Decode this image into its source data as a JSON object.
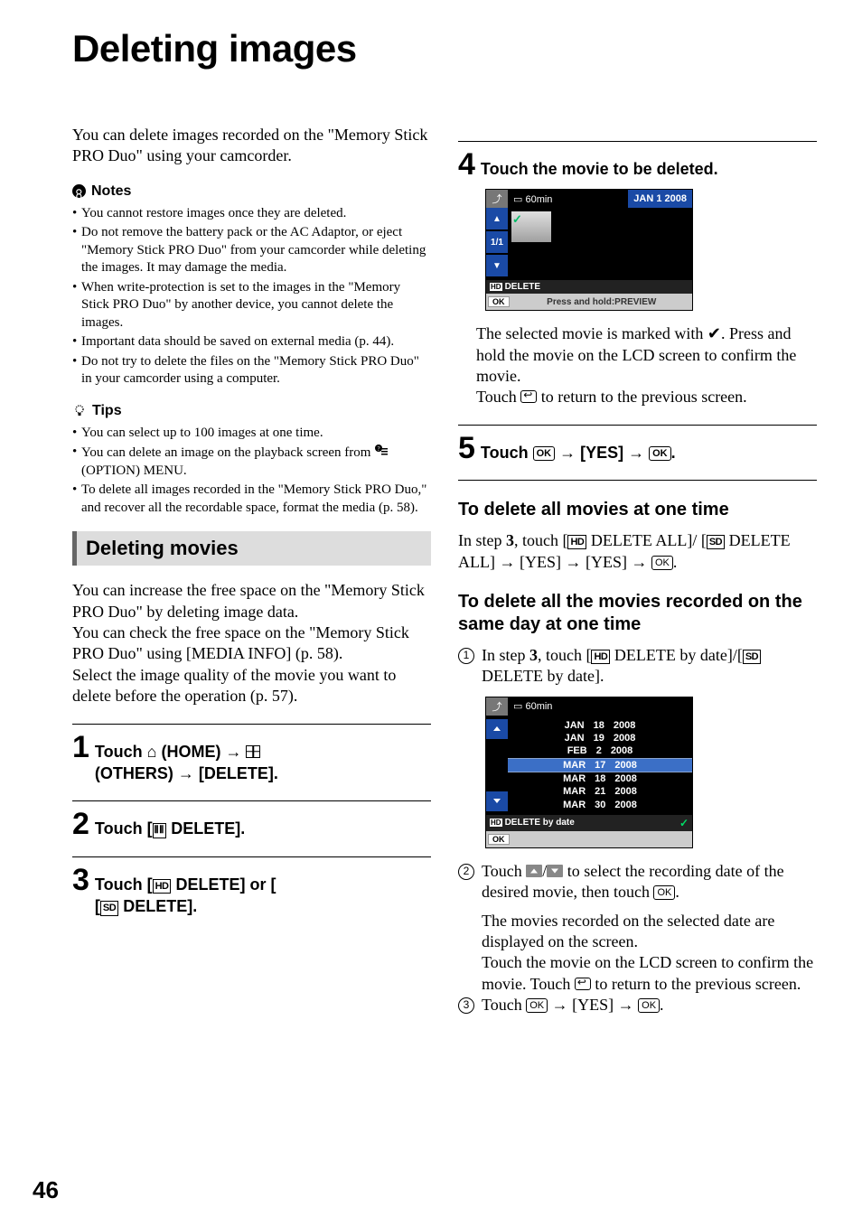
{
  "page_number": "46",
  "title": "Deleting images",
  "intro": "You can delete images recorded on the \"Memory Stick PRO Duo\" using your camcorder.",
  "notes_label": "Notes",
  "notes": [
    "You cannot restore images once they are deleted.",
    "Do not remove the battery pack or the AC Adaptor, or eject \"Memory Stick PRO Duo\" from your camcorder while deleting the images. It may damage the media.",
    "When write-protection is set to the images in the \"Memory Stick PRO Duo\" by another device, you cannot delete the images.",
    "Important data should be saved on external media (p. 44).",
    "Do not try to delete the files on the \"Memory Stick PRO Duo\" in your camcorder using a computer."
  ],
  "tips_label": "Tips",
  "tips": [
    "You can select up to 100 images at one time.",
    "You can delete an image on the playback screen from      (OPTION) MENU.",
    "To delete all images recorded in the \"Memory Stick PRO Duo,\" and recover all the recordable space, format the media (p. 58)."
  ],
  "section_heading": "Deleting movies",
  "movies_body1": "You can increase the free space on the \"Memory Stick PRO Duo\" by deleting image data.",
  "movies_body2": "You can check the free space on the \"Memory Stick PRO Duo\" using [MEDIA INFO] (p. 58).",
  "movies_body3": "Select the image quality of the movie you want to delete before the operation (p. 57).",
  "steps": {
    "s1_pre": "Touch ",
    "s1_home": " (HOME) → ",
    "s1_others": " (OTHERS) → [DELETE].",
    "s2": "Touch [      DELETE].",
    "s3_pre": "Touch [",
    "s3_mid": " DELETE] or [",
    "s3_post": " DELETE].",
    "s4": "Touch the movie to be deleted.",
    "s4_body1": "The selected movie is marked with  ",
    "s4_body2": ". Press and hold the movie on the LCD screen to confirm the movie.",
    "s4_body3": "Touch ",
    "s4_body4": " to return to the previous screen.",
    "s5_pre": "Touch ",
    "s5_mid": " → [YES] → ",
    "s5_post": "."
  },
  "sub1_heading": "To delete all movies at one time",
  "sub1_body_pre": "In step ",
  "sub1_body_bold": "3",
  "sub1_body_mid1": ", touch [",
  "sub1_body_mid2": " DELETE ALL]/ [",
  "sub1_body_mid3": " DELETE ALL] → [YES] → [YES] → ",
  "sub1_body_post": ".",
  "sub2_heading": "To delete all the movies recorded on the same day at one time",
  "sub2_1_pre": "In step ",
  "sub2_1_bold": "3",
  "sub2_1_mid1": ", touch [",
  "sub2_1_mid2": " DELETE by date]/[",
  "sub2_1_mid3": " DELETE by date].",
  "sub2_2_pre": "Touch ",
  "sub2_2_mid": "/",
  "sub2_2_post": " to select the recording date of the desired movie, then touch ",
  "sub2_2_end": ".",
  "sub2_2_body1": "The movies recorded on the selected date are displayed on the screen.",
  "sub2_2_body2_pre": "Touch the movie on the LCD screen to confirm the movie. Touch ",
  "sub2_2_body2_post": " to return to the previous screen.",
  "sub2_3_pre": "Touch ",
  "sub2_3_mid": " → [YES] → ",
  "sub2_3_post": ".",
  "ui1": {
    "battery": "60min",
    "date": "JAN 1 2008",
    "count": "1/1",
    "label": "DELETE",
    "hint": "Press and hold:PREVIEW",
    "ok": "OK"
  },
  "ui2": {
    "battery": "60min",
    "dates": [
      {
        "m": "JAN",
        "d": "18",
        "y": "2008"
      },
      {
        "m": "JAN",
        "d": "19",
        "y": "2008"
      },
      {
        "m": "FEB",
        "d": "2",
        "y": "2008"
      },
      {
        "m": "MAR",
        "d": "17",
        "y": "2008"
      },
      {
        "m": "MAR",
        "d": "18",
        "y": "2008"
      },
      {
        "m": "MAR",
        "d": "21",
        "y": "2008"
      },
      {
        "m": "MAR",
        "d": "30",
        "y": "2008"
      }
    ],
    "selected_index": 3,
    "label": "DELETE by date",
    "ok": "OK"
  }
}
